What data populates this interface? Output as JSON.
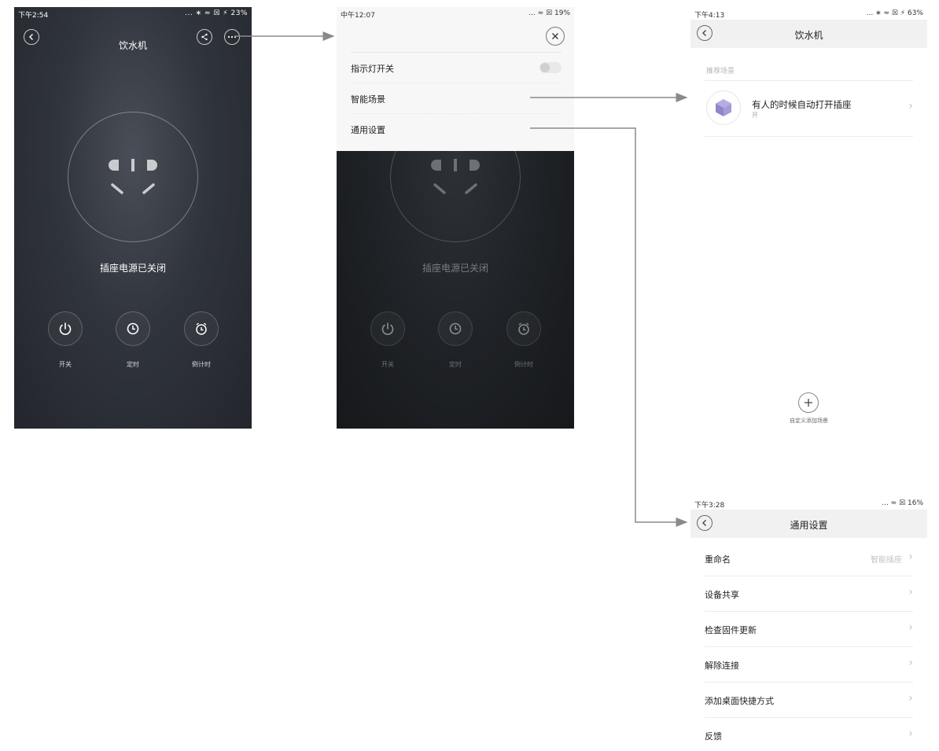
{
  "screen1": {
    "status_time": "下午2:54",
    "status_right": "... ∗ ≈ ☒ ⚡ 23%",
    "title": "饮水机",
    "state_text": "插座电源已关闭",
    "controls": [
      {
        "label": "开关"
      },
      {
        "label": "定时"
      },
      {
        "label": "倒计时"
      }
    ]
  },
  "screen2": {
    "status_time": "中午12:07",
    "status_right": "... ≈ ☒ 19%",
    "menu": {
      "items": [
        {
          "label": "指示灯开关",
          "toggle": false
        },
        {
          "label": "智能场景"
        },
        {
          "label": "通用设置"
        }
      ]
    },
    "state_text": "插座电源已关闭",
    "controls": [
      {
        "label": "开关"
      },
      {
        "label": "定时"
      },
      {
        "label": "倒计时"
      }
    ]
  },
  "screen3": {
    "status_time": "下午4:13",
    "status_right": "... ∗ ≈ ☒ ⚡ 63%",
    "title": "饮水机",
    "section_header": "推荐场景",
    "scene": {
      "title": "有人的时候自动打开插座",
      "subtitle": "开"
    },
    "add_label": "自定义添加场景"
  },
  "screen4": {
    "status_time": "下午3:28",
    "status_right": "... ≈ ☒ 16%",
    "title": "通用设置",
    "rows": [
      {
        "label": "重命名",
        "value": "智能插座"
      },
      {
        "label": "设备共享"
      },
      {
        "label": "检查固件更新"
      },
      {
        "label": "解除连接"
      },
      {
        "label": "添加桌面快捷方式"
      },
      {
        "label": "反馈"
      }
    ]
  },
  "colors": {
    "dark_bg": "#2c3038",
    "light_nav": "#f1f1f1",
    "arrow": "#8a8a8a",
    "battery_green": "#3ec14a",
    "scene_icon": "#8f86c9"
  }
}
